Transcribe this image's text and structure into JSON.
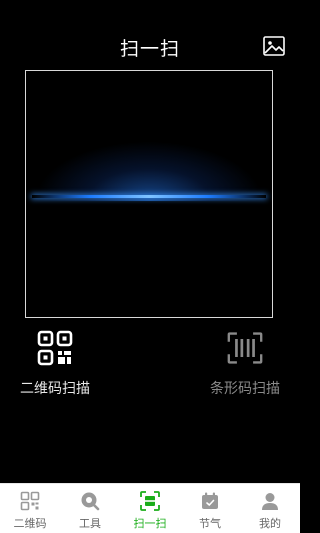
{
  "header": {
    "title": "扫一扫",
    "gallery_icon": "image-icon"
  },
  "modes": [
    {
      "label": "二维码扫描",
      "icon": "qr-code-icon",
      "active": true
    },
    {
      "label": "条形码扫描",
      "icon": "barcode-icon",
      "active": false
    }
  ],
  "tabbar": {
    "items": [
      {
        "label": "二维码",
        "icon": "qr-grid-icon"
      },
      {
        "label": "工具",
        "icon": "tool-icon"
      },
      {
        "label": "扫一扫",
        "icon": "scan-icon",
        "active": true
      },
      {
        "label": "节气",
        "icon": "calendar-icon"
      },
      {
        "label": "我的",
        "icon": "user-icon"
      }
    ]
  },
  "colors": {
    "background": "#000000",
    "accent": "#1aad19",
    "scan_line": "#1d7cff",
    "inactive_tab_icon": "#999999",
    "inactive_tab_text": "#666666"
  }
}
